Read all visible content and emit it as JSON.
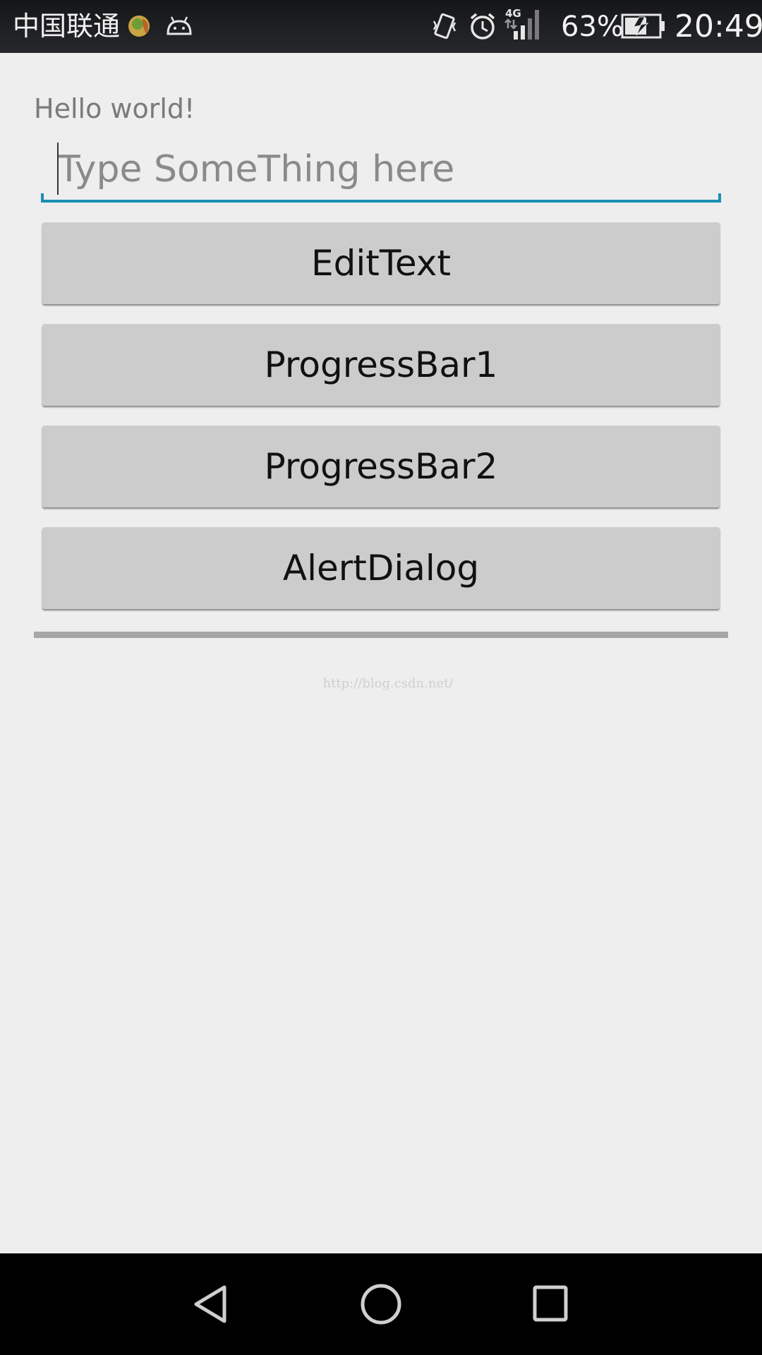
{
  "status_bar": {
    "carrier": "中国联通",
    "signal_type": "4G",
    "battery_percent": "63%",
    "time": "20:49",
    "icons": [
      "app-notification-icon",
      "android-debug-icon",
      "vibrate-icon",
      "alarm-icon",
      "signal-icon",
      "battery-charging-icon"
    ]
  },
  "main": {
    "hello_text": "Hello world!",
    "edit_placeholder": "Type SomeThing here",
    "edit_value": "",
    "buttons": [
      {
        "label": "EditText"
      },
      {
        "label": "ProgressBar1"
      },
      {
        "label": "ProgressBar2"
      },
      {
        "label": "AlertDialog"
      }
    ],
    "progress": 1.0,
    "watermark": "http://blog.csdn.net/"
  },
  "nav_bar": {
    "icons": [
      "back-icon",
      "home-icon",
      "recent-apps-icon"
    ]
  },
  "colors": {
    "accent": "#1a8fb4",
    "background": "#eeeeee",
    "button": "#cccccc",
    "progress": "#a6a6a6"
  }
}
